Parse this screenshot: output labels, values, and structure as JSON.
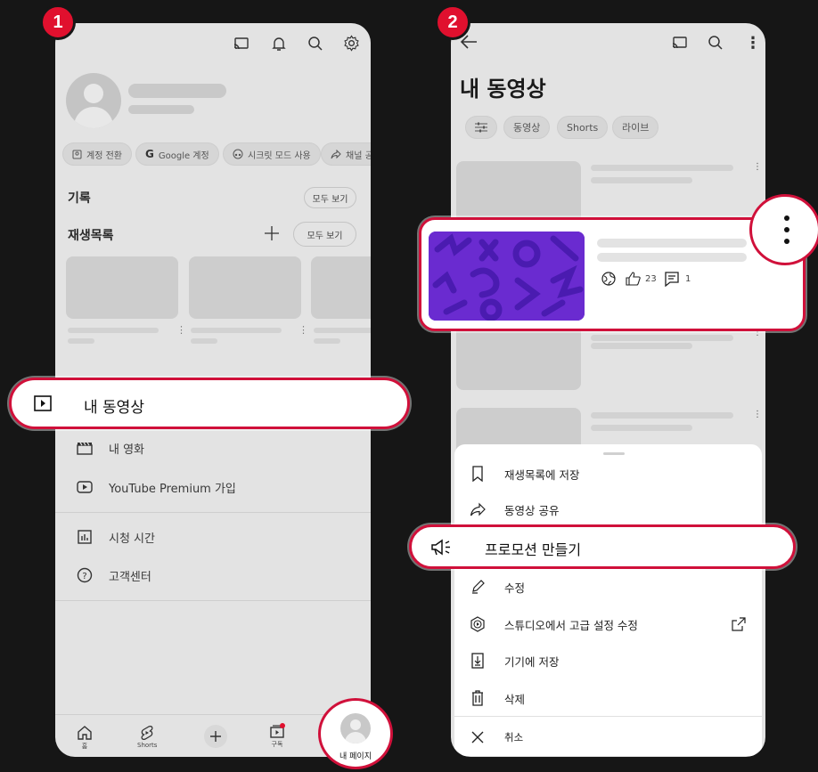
{
  "steps": {
    "step1": "1",
    "step2": "2"
  },
  "left": {
    "account_chips": [
      {
        "icon": "switch-account-icon",
        "label": "계정 전환"
      },
      {
        "icon": "google-g-icon",
        "label": "Google 계정"
      },
      {
        "icon": "incognito-icon",
        "label": "시크릿 모드 사용"
      },
      {
        "icon": "share-icon",
        "label": "채널 공"
      }
    ],
    "history_label": "기록",
    "history_view_all": "모두 보기",
    "playlist_label": "재생목록",
    "playlist_view_all": "모두 보기",
    "highlight_label": "내 동영상",
    "menu": [
      {
        "icon": "clapper-icon",
        "label": "내 영화"
      },
      {
        "icon": "youtube-premium-icon",
        "label": "YouTube Premium 가입"
      },
      {
        "icon": "bar-chart-icon",
        "label": "시청 시간"
      },
      {
        "icon": "help-icon",
        "label": "고객센터"
      }
    ],
    "bottom_nav": [
      {
        "icon": "home-icon",
        "label": "홈"
      },
      {
        "icon": "shorts-icon",
        "label": "Shorts"
      },
      {
        "icon": "create-icon",
        "label": ""
      },
      {
        "icon": "subscriptions-icon",
        "label": "구독"
      }
    ],
    "my_page_label": "내 페이지"
  },
  "right": {
    "title": "내 동영상",
    "filter_chips": [
      "동영상",
      "Shorts",
      "라이브"
    ],
    "video_stats": {
      "likes": "23",
      "comments": "1"
    },
    "sheet_items": [
      {
        "icon": "bookmark-icon",
        "label": "재생목록에 저장"
      },
      {
        "icon": "share-icon",
        "label": "동영상 공유"
      },
      {
        "icon": "pencil-icon",
        "label": "수정"
      },
      {
        "icon": "studio-icon",
        "label": "스튜디오에서 고급 설정 수정"
      },
      {
        "icon": "download-icon",
        "label": "기기에 저장"
      },
      {
        "icon": "trash-icon",
        "label": "삭제"
      }
    ],
    "promotion_label": "프로모션 만들기",
    "cancel_label": "취소"
  },
  "colors": {
    "accent": "#d0103a",
    "badge": "#e0102e",
    "thumb": "#6a2bd0"
  }
}
